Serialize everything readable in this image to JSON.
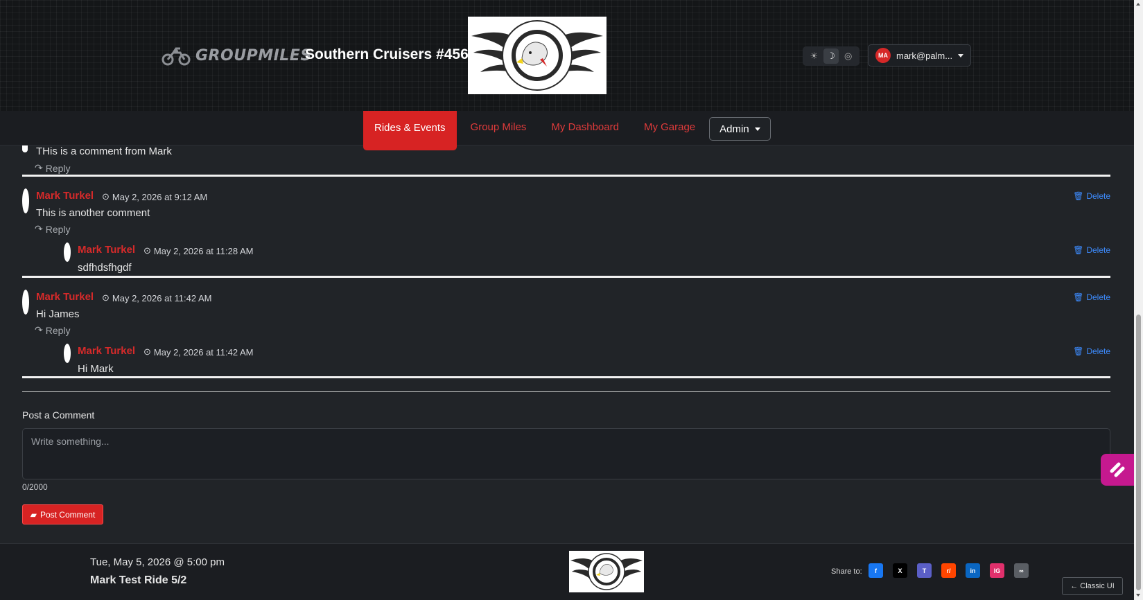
{
  "header": {
    "brand_name": "GROUPMILES",
    "club_title": "Southern Cruisers #456",
    "logo_text_top": "SOUTHERN",
    "logo_text_mid": "CRUISERS",
    "logo_text_bottom": "RIDING CLUB",
    "theme_icons": [
      "sun-icon",
      "moon-icon",
      "auto-icon"
    ],
    "user": {
      "initials": "MA",
      "email": "mark@palm..."
    }
  },
  "nav": {
    "items": [
      "Rides & Events",
      "Group Miles",
      "My Dashboard",
      "My Garage"
    ],
    "active": "Rides & Events",
    "admin_label": "Admin"
  },
  "comments": {
    "reply_label": "Reply",
    "delete_label": "Delete",
    "top_partial": {
      "text": "THis is a comment from Mark"
    },
    "threads": [
      {
        "author": "Mark Turkel",
        "time": "May 2, 2026 at 9:12 AM",
        "text": "This is another comment",
        "reply": {
          "author": "Mark Turkel",
          "time": "May 2, 2026 at 11:28 AM",
          "text": "sdfhdsfhgdf"
        }
      },
      {
        "author": "Mark Turkel",
        "time": "May 2, 2026 at 11:42 AM",
        "text": "Hi James",
        "reply": {
          "author": "Mark Turkel",
          "time": "May 2, 2026 at 11:42 AM",
          "text": "Hi Mark"
        }
      }
    ]
  },
  "post": {
    "label": "Post a Comment",
    "placeholder": "Write something...",
    "char_count": "0/2000",
    "button_label": "Post Comment"
  },
  "footer": {
    "date": "Tue, May 5, 2026 @ 5:00 pm",
    "title": "Mark Test Ride 5/2",
    "share_label": "Share to:",
    "share": [
      {
        "name": "facebook",
        "glyph": "f",
        "color": "#1877f2"
      },
      {
        "name": "x",
        "glyph": "X",
        "color": "#000000"
      },
      {
        "name": "teams",
        "glyph": "T",
        "color": "#5b5fc7"
      },
      {
        "name": "reddit",
        "glyph": "r/",
        "color": "#ff4500"
      },
      {
        "name": "linkedin",
        "glyph": "in",
        "color": "#0a66c2"
      },
      {
        "name": "instagram",
        "glyph": "IG",
        "color": "#e1306c"
      },
      {
        "name": "copy-link",
        "glyph": "∞",
        "color": "#5a5e64"
      }
    ],
    "classic_label": "← Classic UI"
  },
  "colors": {
    "accent": "#d72323",
    "link": "#3d8bfd",
    "background": "#212428"
  }
}
